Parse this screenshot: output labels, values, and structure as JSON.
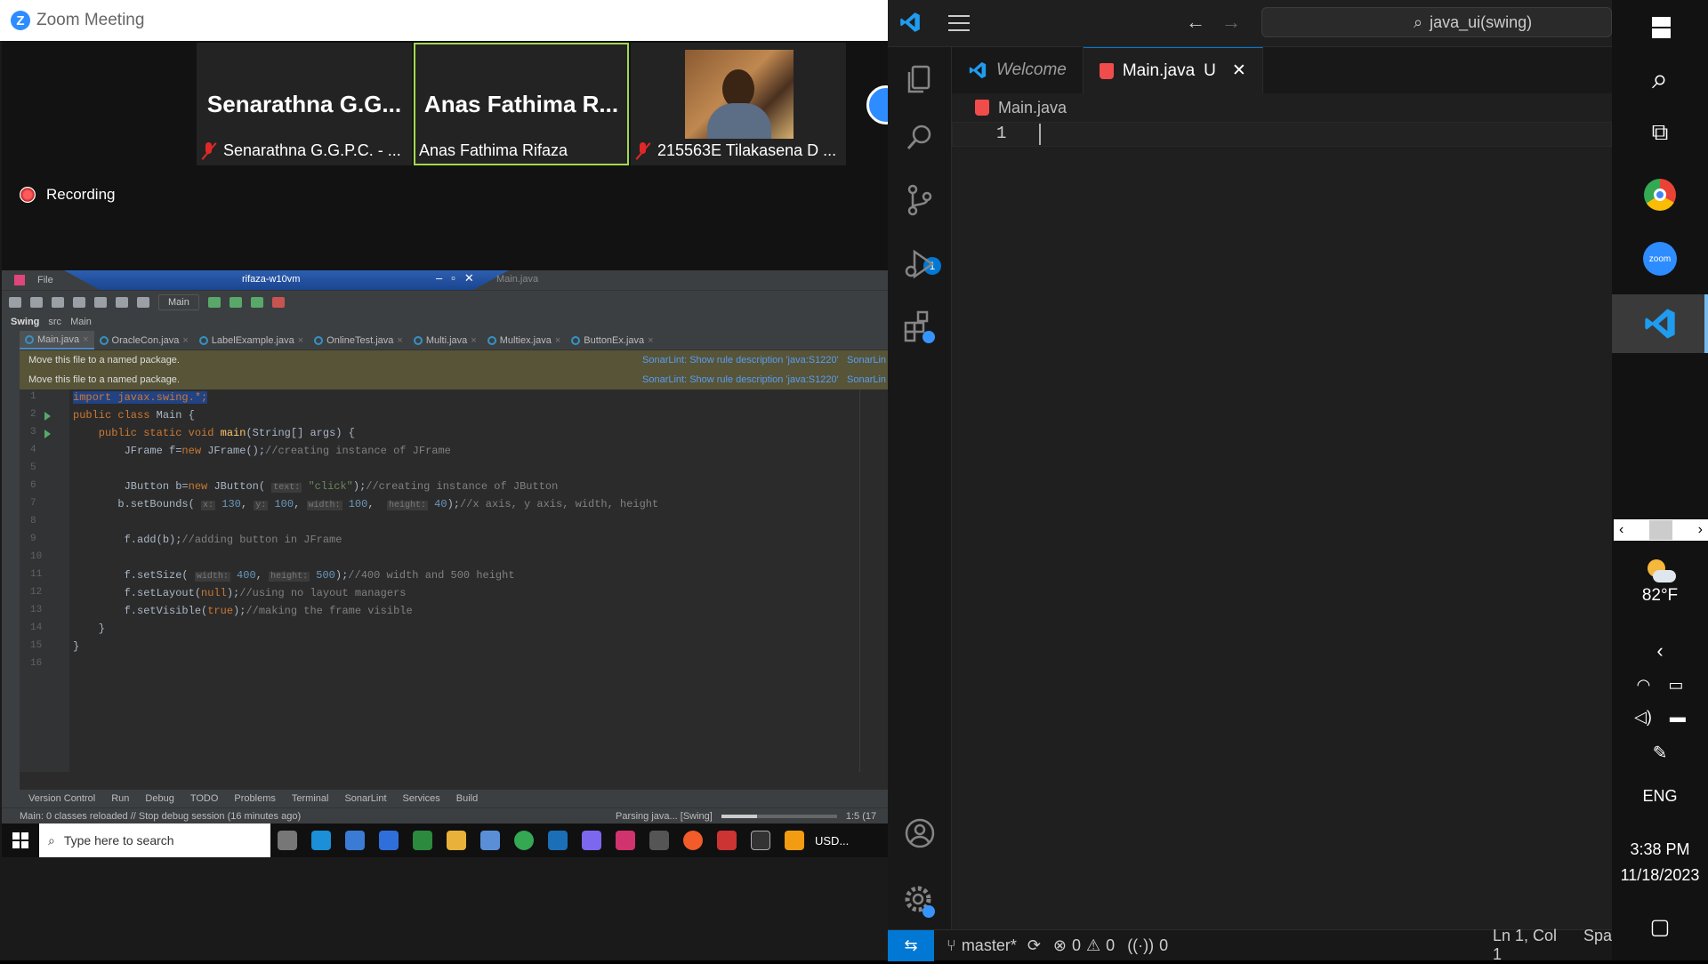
{
  "zoom": {
    "title": "Zoom Meeting",
    "logo_letter": "Z",
    "participants": [
      {
        "display_name": "Senarathna  G.G...",
        "caption": "Senarathna G.G.P.C. - ...",
        "muted": true,
        "active_speaker": false
      },
      {
        "display_name": "Anas  Fathima  R...",
        "caption": "Anas Fathima Rifaza",
        "muted": false,
        "active_speaker": true
      },
      {
        "display_name": "",
        "caption": "215563E Tilakasena D ...",
        "muted": true,
        "active_speaker": false
      }
    ],
    "recording_label": "Recording",
    "accent_color": "#2d8cff",
    "active_speaker_border": "#a2d94f"
  },
  "ide": {
    "menu_file": "File",
    "remote_title": "rifaza-w10vm",
    "remote_file": "Main.java",
    "run_config": "Main",
    "breadcrumb": [
      "Swing",
      "src",
      "Main"
    ],
    "tabs": [
      "Main.java",
      "OracleCon.java",
      "LabelExample.java",
      "OnlineTest.java",
      "Multi.java",
      "Multiex.java",
      "ButtonEx.java"
    ],
    "warnings": [
      {
        "text": "Move this file to a named package.",
        "link": "SonarLint: Show rule description 'java:S1220'",
        "link2": "SonarLin"
      },
      {
        "text": "Move this file to a named package.",
        "link": "SonarLint: Show rule description 'java:S1220'",
        "link2": "SonarLin"
      }
    ],
    "line_numbers": [
      "1",
      "2",
      "3",
      "4",
      "5",
      "6",
      "7",
      "8",
      "9",
      "10",
      "11",
      "12",
      "13",
      "14",
      "15",
      "16"
    ],
    "code": {
      "l1": "import javax.swing.*;",
      "l2a": "public class ",
      "l2b": "Main {",
      "l3a": "    public static void ",
      "l3b": "main",
      "l3c": "(String[] args) {",
      "l4a": "        JFrame f=",
      "l4b": "new ",
      "l4c": "JFrame();",
      "l4d": "//creating instance of JFrame",
      "l6a": "        JButton b=",
      "l6b": "new ",
      "l6c": "JButton( ",
      "l6h": "text:",
      "l6d": " \"click\"",
      "l6e": ");",
      "l6f": "//creating instance of JButton",
      "l7a": "       b.setBounds( ",
      "l7h1": "x:",
      "l7v1": " 130",
      "l7s1": ", ",
      "l7h2": "y:",
      "l7v2": " 100",
      "l7s2": ", ",
      "l7h3": "width:",
      "l7v3": " 100",
      "l7s3": ",  ",
      "l7h4": "height:",
      "l7v4": " 40",
      "l7e": ");",
      "l7c": "//x axis, y axis, width, height",
      "l9a": "        f.add(b);",
      "l9b": "//adding button in JFrame",
      "l11a": "        f.setSize( ",
      "l11h1": "width:",
      "l11v1": " 400",
      "l11s": ", ",
      "l11h2": "height:",
      "l11v2": " 500",
      "l11e": ");",
      "l11c": "//400 width and 500 height",
      "l12a": "        f.setLayout(",
      "l12b": "null",
      "l12c": ");",
      "l12d": "//using no layout managers",
      "l13a": "        f.setVisible(",
      "l13b": "true",
      "l13c": ");",
      "l13d": "//making the frame visible",
      "l14": "    }",
      "l15": "}"
    },
    "bottom_tools": [
      "Version Control",
      "Run",
      "Debug",
      "TODO",
      "Problems",
      "Terminal",
      "SonarLint",
      "Services",
      "Build"
    ],
    "status_text": "Main: 0 classes reloaded // Stop debug session (16 minutes ago)",
    "status_parsing": "Parsing java... [Swing]",
    "status_pos": "1:5 (17"
  },
  "remote_taskbar": {
    "search_placeholder": "Type here to search",
    "ticker": "USD..."
  },
  "vscode": {
    "search_text": "java_ui(swing)",
    "tabs": [
      {
        "label": "Welcome",
        "italic": true
      },
      {
        "label": "Main.java",
        "modifier": "U",
        "active": true
      }
    ],
    "breadcrumb_file": "Main.java",
    "line_number": "1",
    "scm_badge": "1",
    "status": {
      "branch": "master*",
      "errors": "0",
      "warnings": "0",
      "ports": "0",
      "cursor": "Ln 1, Col 1",
      "spaces": "Spa"
    },
    "accent_color": "#0078d4"
  },
  "windows_taskbar": {
    "weather_temp": "82°F",
    "language": "ENG",
    "time": "3:38 PM",
    "date": "11/18/2023",
    "zoom_icon_label": "zoom"
  }
}
